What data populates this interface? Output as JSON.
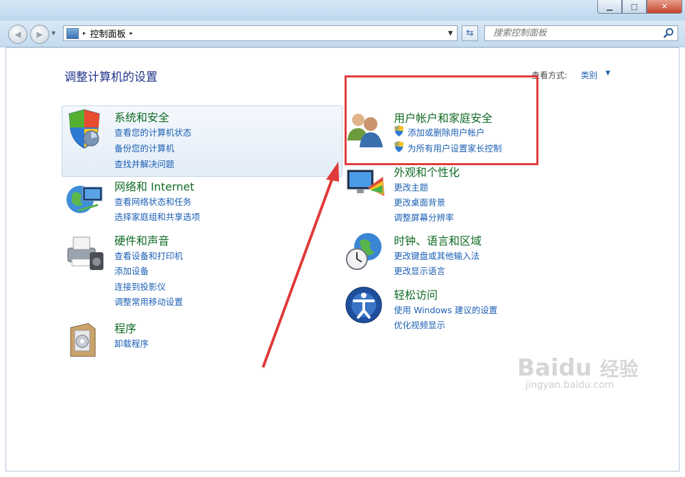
{
  "address": {
    "path": "控制面板",
    "sep": "▸"
  },
  "search": {
    "placeholder": "搜索控制面板"
  },
  "header": {
    "title": "调整计算机的设置",
    "view_by_label": "查看方式:",
    "view_by_value": "类别"
  },
  "categories": [
    {
      "title": "系统和安全",
      "icon": "shield-icon",
      "links": [
        "查看您的计算机状态",
        "备份您的计算机",
        "查找并解决问题"
      ]
    },
    {
      "title": "网络和 Internet",
      "icon": "network-globe-icon",
      "links": [
        "查看网络状态和任务",
        "选择家庭组和共享选项"
      ]
    },
    {
      "title": "硬件和声音",
      "icon": "printer-icon",
      "links": [
        "查看设备和打印机",
        "添加设备",
        "连接到投影仪",
        "调整常用移动设置"
      ]
    },
    {
      "title": "程序",
      "icon": "program-box-icon",
      "links": [
        "卸载程序"
      ]
    },
    {
      "title": "用户帐户和家庭安全",
      "icon": "users-icon",
      "links": [
        "添加或删除用户帐户",
        "为所有用户设置家长控制"
      ]
    },
    {
      "title": "外观和个性化",
      "icon": "monitor-palette-icon",
      "links": [
        "更改主题",
        "更改桌面背景",
        "调整屏幕分辨率"
      ]
    },
    {
      "title": "时钟、语言和区域",
      "icon": "globe-clock-icon",
      "links": [
        "更改键盘或其他输入法",
        "更改显示语言"
      ]
    },
    {
      "title": "轻松访问",
      "icon": "ease-of-access-icon",
      "links": [
        "使用 Windows 建议的设置",
        "优化视频显示"
      ]
    }
  ],
  "watermark": {
    "brand": "Baidu",
    "brand_suffix": "经验",
    "url": "jingyan.baidu.com"
  },
  "colors": {
    "category_title": "#0f6a23",
    "link": "#1b5fb3",
    "page_title": "#1e3287",
    "annotation": "#e03a3a"
  }
}
